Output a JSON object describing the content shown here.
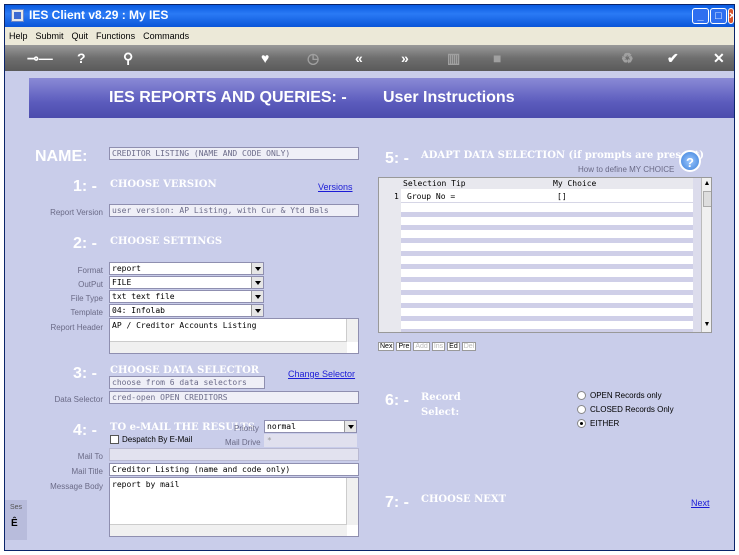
{
  "window": {
    "title": "IES Client v8.29 : My IES",
    "controls": [
      "_",
      "□",
      "×"
    ]
  },
  "menu": [
    "Help",
    "Submit",
    "Quit",
    "Functions",
    "Commands"
  ],
  "toolbar": {
    "icons": [
      "key-icon",
      "help-icon",
      "search-icon",
      "heart-icon",
      "clock-icon",
      "rewind-icon",
      "forward-icon",
      "bin-icon",
      "stop-icon",
      "recycle-icon",
      "check-icon",
      "close-icon"
    ]
  },
  "banner": {
    "title": "IES REPORTS AND QUERIES: -",
    "subtitle": "User Instructions"
  },
  "name": {
    "label": "NAME:",
    "value": "CREDITOR LISTING (NAME AND CODE ONLY)"
  },
  "s1": {
    "num": "1: -",
    "title": "CHOOSE VERSION",
    "link": "Versions",
    "label": "Report Version",
    "value": "user version: AP Listing, with Cur & Ytd Bals"
  },
  "s2": {
    "num": "2: -",
    "title": "CHOOSE SETTINGS",
    "format_label": "Format",
    "format_value": "report",
    "output_label": "OutPut",
    "output_value": "FILE",
    "filetype_label": "File Type",
    "filetype_value": "txt text file",
    "template_label": "Template",
    "template_value": "04: Infolab",
    "header_label": "Report Header",
    "header_value": "AP / Creditor Accounts Listing"
  },
  "s3": {
    "num": "3: -",
    "title": "CHOOSE DATA SELECTOR",
    "link": "Change Selector",
    "info": "choose from 6 data selectors",
    "label": "Data Selector",
    "value": "cred-open OPEN CREDITORS"
  },
  "s4": {
    "num": "4: -",
    "title": "TO e-MAIL THE RESULTS",
    "despatch_label": "Despatch By E-Mail",
    "priority_label": "Priority",
    "priority_value": "normal",
    "drive_label": "Mail Drive",
    "drive_value": "*",
    "mailto_label": "Mail To",
    "mailtitle_label": "Mail Title",
    "mailtitle_value": "Creditor Listing (name and code only)",
    "body_label": "Message Body",
    "body_value": "report by mail"
  },
  "s5": {
    "num": "5: -",
    "title": "ADAPT DATA SELECTION (if prompts are present)",
    "hint": "How to define MY CHOICE",
    "col1": "Selection Tip",
    "col2": "My Choice",
    "rows": [
      {
        "n": "1",
        "tip": "Group No =",
        "choice": "[]"
      }
    ],
    "buttons": [
      "Nex",
      "Pre",
      "Add",
      "Ins",
      "Ed",
      "Del"
    ]
  },
  "s6": {
    "num": "6: -",
    "title1": "Record",
    "title2": "Select:",
    "options": [
      "OPEN Records only",
      "CLOSED Records Only",
      "EITHER"
    ]
  },
  "s7": {
    "num": "7: -",
    "title": "CHOOSE NEXT",
    "link": "Next"
  },
  "side": {
    "text": "Ses"
  }
}
